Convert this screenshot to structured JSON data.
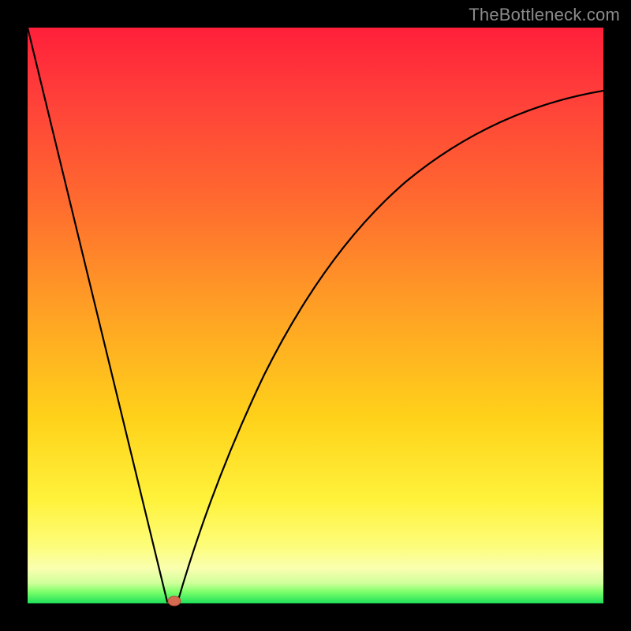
{
  "watermark": "TheBottleneck.com",
  "chart_data": {
    "type": "line",
    "title": "",
    "xlabel": "",
    "ylabel": "",
    "xlim": [
      0,
      100
    ],
    "ylim": [
      0,
      100
    ],
    "grid": false,
    "legend": false,
    "series": [
      {
        "name": "left-branch",
        "x": [
          0,
          24
        ],
        "values": [
          100,
          0
        ],
        "note": "straight descending line from top-left to minimum"
      },
      {
        "name": "right-branch",
        "x": [
          26,
          30,
          35,
          40,
          45,
          50,
          55,
          60,
          65,
          70,
          75,
          80,
          85,
          90,
          95,
          100
        ],
        "values": [
          0,
          14,
          29,
          41,
          51,
          59,
          66,
          71,
          76,
          79,
          82,
          84,
          86,
          87.5,
          88.5,
          89
        ],
        "note": "concave-down rising curve from minimum toward top-right, asymptoting near 89"
      }
    ],
    "marker": {
      "name": "min-point",
      "x": 25,
      "y": 0,
      "color": "#d46a4f",
      "shape": "ellipse"
    },
    "background_gradient": {
      "direction": "vertical",
      "stops": [
        {
          "pos": 0.0,
          "color": "#ff1f3a"
        },
        {
          "pos": 0.5,
          "color": "#ffa324"
        },
        {
          "pos": 0.82,
          "color": "#fff23b"
        },
        {
          "pos": 0.97,
          "color": "#cfff9a"
        },
        {
          "pos": 1.0,
          "color": "#1fe05a"
        }
      ]
    }
  }
}
